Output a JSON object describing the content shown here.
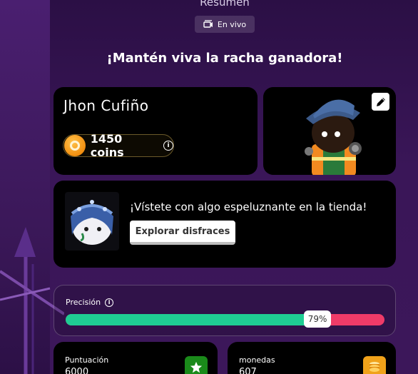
{
  "header": {
    "title": "Resumen",
    "live_label": "En vivo"
  },
  "headline": "¡Mantén viva la racha ganadora!",
  "player": {
    "name": "Jhon Cufiño",
    "coins": "1450 coins"
  },
  "shop": {
    "message": "¡Vístete con algo espeluznante en la tienda!",
    "button_label": "Explorar disfraces"
  },
  "accuracy": {
    "label": "Precisión",
    "percent": 79,
    "percent_label": "79%",
    "colors": {
      "correct": "#1fcd93",
      "incorrect": "#ef3b68"
    }
  },
  "stats": [
    {
      "label": "Puntuación",
      "value": "6000",
      "icon": "star-icon",
      "icon_color": "#1a8a1a"
    },
    {
      "label": "monedas",
      "value": "607",
      "icon": "coins-stack-icon",
      "icon_color": "#f0a21a"
    }
  ]
}
